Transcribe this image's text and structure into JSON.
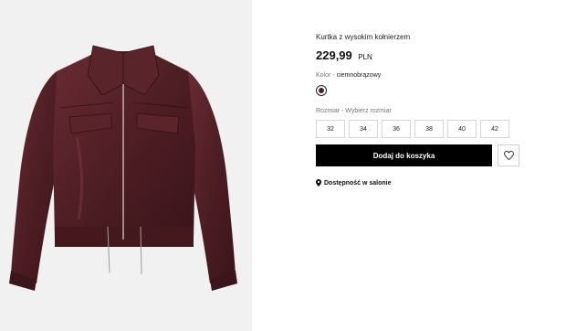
{
  "product": {
    "title": "Kurtka z wysokim kołnierzem",
    "price_amount": "229,99",
    "price_currency": "PLN",
    "image_icon": "leather-jacket-image",
    "jacket_color": "#4e1e24"
  },
  "color": {
    "label": "Kolor",
    "separator": " - ",
    "value": "ciemnobrązowy",
    "swatch_color": "#4a2128"
  },
  "size": {
    "label": "Rozmiar",
    "separator": "  - ",
    "prompt": "Wybierz rozmiar",
    "options": [
      "32",
      "34",
      "36",
      "38",
      "40",
      "42"
    ]
  },
  "actions": {
    "add_to_cart": "Dodaj do koszyka",
    "wishlist_icon": "heart-icon"
  },
  "availability": {
    "icon": "location-pin-icon",
    "text": "Dostępność w salonie"
  }
}
